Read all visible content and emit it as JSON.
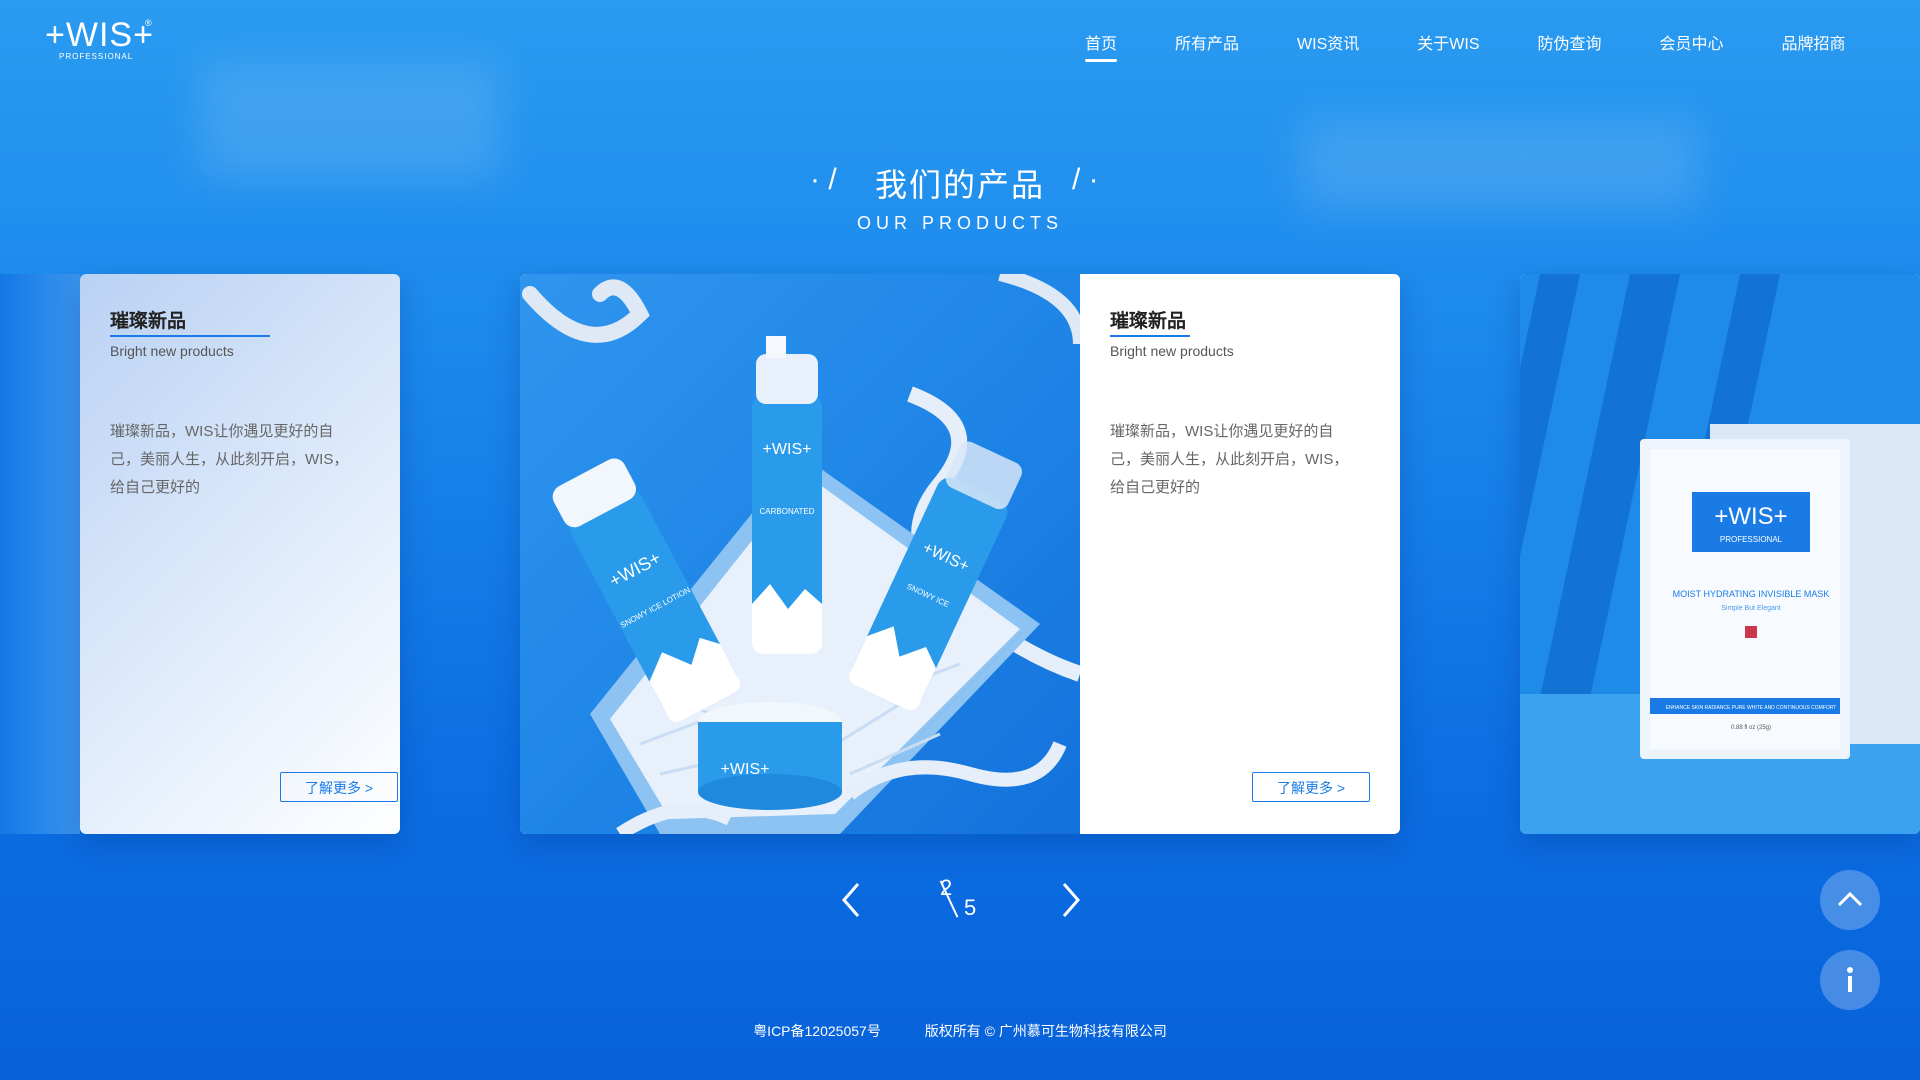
{
  "brand": {
    "logo_text": "+WIS+",
    "logo_reg": "®",
    "logo_sub": "PROFESSIONAL"
  },
  "nav": {
    "items": [
      {
        "label": "首页",
        "active": true
      },
      {
        "label": "所有产品"
      },
      {
        "label": "WIS资讯"
      },
      {
        "label": "关于WIS"
      },
      {
        "label": "防伪查询"
      },
      {
        "label": "会员中心"
      },
      {
        "label": "品牌招商"
      }
    ]
  },
  "section": {
    "title": "我们的产品",
    "subtitle": "OUR PRODUCTS"
  },
  "cards": {
    "left": {
      "title": "璀璨新品",
      "subtitle": "Bright new products",
      "desc": "璀璨新品，WIS让你遇见更好的自己，美丽人生，从此刻开启，WIS，给自己更好的",
      "button": "了解更多 >"
    },
    "main": {
      "title": "璀璨新品",
      "subtitle": "Bright new products",
      "desc": "璀璨新品，WIS让你遇见更好的自己，美丽人生，从此刻开启，WIS，给自己更好的",
      "button": "了解更多 >"
    },
    "right": {
      "pack_logo": "+WIS+",
      "pack_sub": "PROFESSIONAL",
      "pack_title": "MOIST HYDRATING INVISIBLE MASK",
      "pack_tagline": "Simple But Elegant",
      "pack_band": "ENHANCE SKIN RADIANCE\nPURE WHITE AND CONTINUOUS COMFORT",
      "pack_weight": "0.88 fl oz (25g)"
    }
  },
  "products": {
    "bottle1": "+WIS+",
    "bottle2": "+WIS+",
    "bottle3": "+WIS+",
    "jar": "+WIS+",
    "label1": "SNOWY ICE LOTION",
    "label2": "CARBONATED",
    "label3": "SNOWY ICE"
  },
  "pager": {
    "current": "2",
    "total": "5"
  },
  "footer": {
    "icp": "粤ICP备12025057号",
    "copyright": "版权所有 © 广州慕可生物科技有限公司"
  },
  "colors": {
    "accent": "#1a7be6",
    "bg_top": "#2a9bf0",
    "bg_bottom": "#0862da"
  }
}
